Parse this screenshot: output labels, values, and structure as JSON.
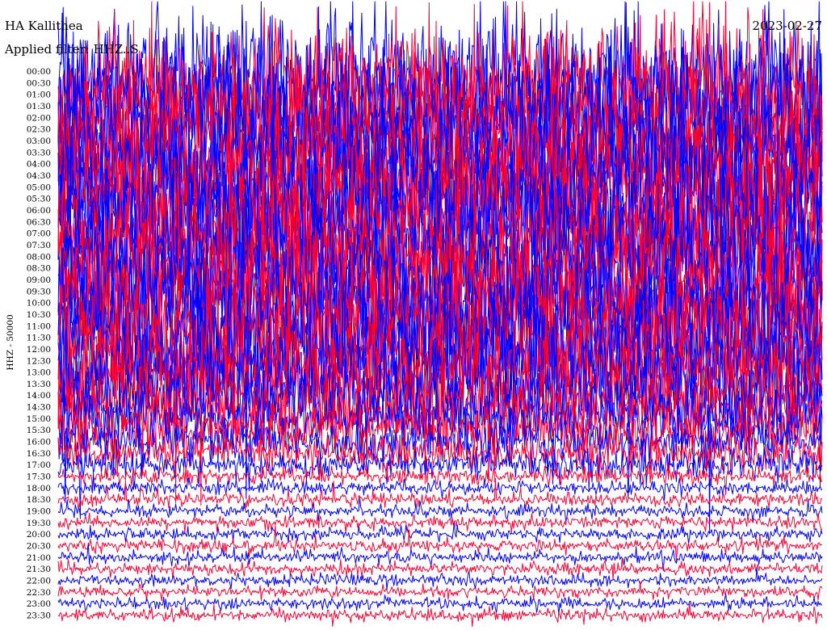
{
  "header": {
    "station": "HA Kallithea",
    "filter_prefix": "Applied filter: ",
    "filter_value": "HHZ..S",
    "date": "2023-02-27"
  },
  "colors": {
    "trace_odd": "#0000ff",
    "trace_even": "#ff0033",
    "background": "#ffffff",
    "text": "#000000"
  },
  "chart_data": {
    "type": "line",
    "title": "HA Kallithea",
    "ylabel": "HHZ - 50000",
    "xlabel": "",
    "rows_per_hour": 2,
    "minutes_per_row": 30,
    "colors_alternate": [
      "#0000ff",
      "#ff0033"
    ],
    "y_tick_labels": [
      "00:00",
      "00:30",
      "01:00",
      "01:30",
      "02:00",
      "02:30",
      "03:00",
      "03:30",
      "04:00",
      "04:30",
      "05:00",
      "05:30",
      "06:00",
      "06:30",
      "07:00",
      "07:30",
      "08:00",
      "08:30",
      "09:00",
      "09:30",
      "10:00",
      "10:30",
      "11:00",
      "11:30",
      "12:00",
      "12:30",
      "13:00",
      "13:30",
      "14:00",
      "14:30",
      "15:00",
      "15:30",
      "16:00",
      "16:30",
      "17:00",
      "17:30",
      "18:00",
      "18:30",
      "19:00",
      "19:30",
      "20:00",
      "20:30",
      "21:00",
      "21:30",
      "22:00",
      "22:30",
      "23:00",
      "23:30"
    ],
    "relative_amplitude": [
      9.0,
      9.0,
      9.0,
      9.0,
      9.0,
      9.0,
      9.0,
      9.0,
      9.0,
      9.0,
      9.0,
      9.0,
      9.0,
      9.0,
      9.0,
      9.0,
      9.0,
      9.0,
      9.0,
      9.0,
      9.0,
      9.0,
      9.0,
      9.0,
      8.5,
      8.0,
      7.5,
      7.0,
      6.0,
      5.0,
      4.0,
      3.5,
      3.0,
      2.6,
      2.0,
      1.2,
      1.0,
      0.95,
      0.9,
      0.9,
      0.85,
      0.85,
      0.85,
      0.8,
      0.8,
      0.8,
      0.8,
      0.8
    ]
  }
}
